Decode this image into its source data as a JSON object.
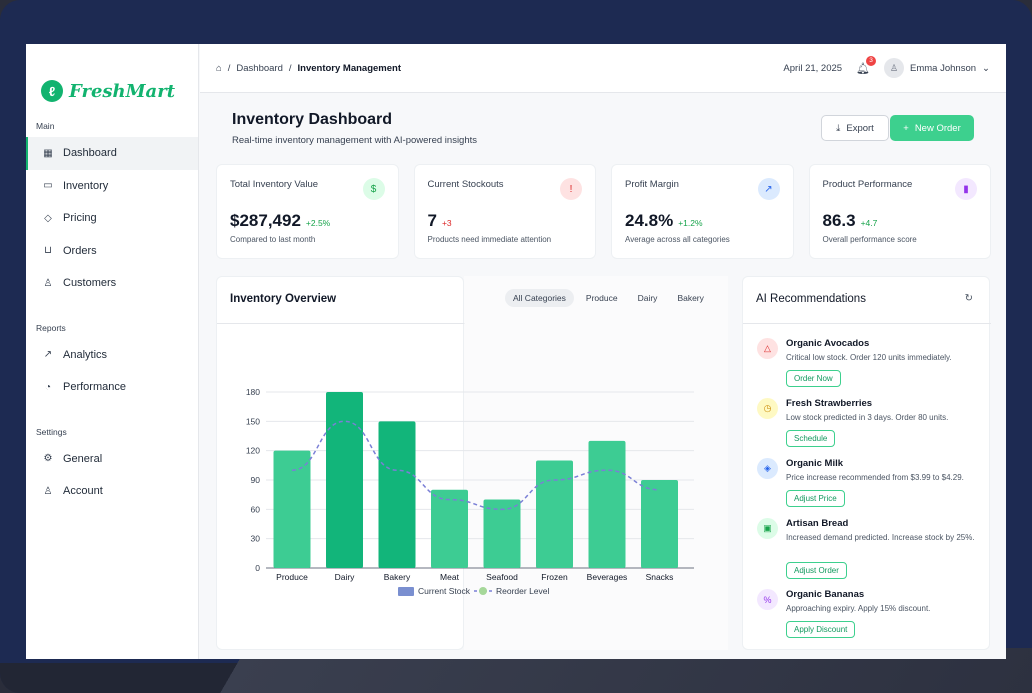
{
  "brand": {
    "name": "FreshMart"
  },
  "sidebar": {
    "sections": [
      {
        "title": "Main",
        "items": [
          {
            "label": "Dashboard",
            "icon": "dashboard-icon",
            "active": true
          },
          {
            "label": "Inventory",
            "icon": "box-icon"
          },
          {
            "label": "Pricing",
            "icon": "tag-icon"
          },
          {
            "label": "Orders",
            "icon": "cart-icon"
          },
          {
            "label": "Customers",
            "icon": "user-icon"
          }
        ]
      },
      {
        "title": "Reports",
        "items": [
          {
            "label": "Analytics",
            "icon": "line-chart-icon"
          },
          {
            "label": "Performance",
            "icon": "pie-chart-icon"
          }
        ]
      },
      {
        "title": "Settings",
        "items": [
          {
            "label": "General",
            "icon": "gear-icon"
          },
          {
            "label": "Account",
            "icon": "account-icon"
          }
        ]
      }
    ]
  },
  "topbar": {
    "breadcrumb": [
      "Dashboard",
      "Inventory Management"
    ],
    "date": "April 21, 2025",
    "notifications": "3",
    "user": "Emma Johnson"
  },
  "page": {
    "title": "Inventory Dashboard",
    "subtitle": "Real-time inventory management with AI-powered insights",
    "export_label": "Export",
    "new_order_label": "New Order"
  },
  "kpis": [
    {
      "label": "Total Inventory Value",
      "value": "$287,492",
      "delta": "+2.5%",
      "note": "Compared to last month",
      "color": "#16a34a",
      "icon_bg": "#dcfce7",
      "icon": "$"
    },
    {
      "label": "Current Stockouts",
      "value": "7",
      "delta": "+3",
      "note": "Products need immediate attention",
      "color": "#dc2626",
      "icon_bg": "#fee2e2",
      "icon": "!"
    },
    {
      "label": "Profit Margin",
      "value": "24.8%",
      "delta": "+1.2%",
      "note": "Average across all categories",
      "color": "#16a34a",
      "icon_bg": "#dbeafe",
      "icon": "↗"
    },
    {
      "label": "Product Performance",
      "value": "86.3",
      "delta": "+4.7",
      "note": "Overall performance score",
      "color": "#16a34a",
      "icon_bg": "#f3e8ff",
      "icon": "▮"
    }
  ],
  "overview": {
    "title": "Inventory Overview",
    "tabs": [
      "All Categories",
      "Produce",
      "Dairy",
      "Bakery"
    ]
  },
  "chart_data": {
    "type": "bar",
    "categories": [
      "Produce",
      "Dairy",
      "Bakery",
      "Meat",
      "Seafood",
      "Frozen",
      "Beverages",
      "Snacks"
    ],
    "series": [
      {
        "name": "Current Stock",
        "type": "bar",
        "values": [
          120,
          180,
          150,
          80,
          70,
          110,
          130,
          90
        ]
      },
      {
        "name": "Reorder Level",
        "type": "line",
        "values": [
          100,
          150,
          100,
          70,
          60,
          90,
          100,
          80
        ]
      }
    ],
    "yticks": [
      0,
      30,
      60,
      90,
      120,
      150,
      180
    ],
    "ylim": [
      0,
      180
    ],
    "legend": "bottom",
    "grid": true,
    "colors": {
      "bar": "#3dcc93",
      "bar_dark": "#12b57a",
      "line": "#7a7fd6",
      "legend_stock": "#7a8fd0",
      "legend_reorder": "#a6d89a"
    }
  },
  "ai": {
    "title": "AI Recommendations",
    "items": [
      {
        "name": "Organic Avocados",
        "desc": "Critical low stock. Order 120 units immediately.",
        "action": "Order Now",
        "icon": "alert-icon",
        "glyph": "△",
        "bg": "#fee2e2",
        "fg": "#dc2626"
      },
      {
        "name": "Fresh Strawberries",
        "desc": "Low stock predicted in 3 days. Order 80 units.",
        "action": "Schedule",
        "icon": "clock-icon",
        "glyph": "◷",
        "bg": "#fef9c3",
        "fg": "#ca8a04"
      },
      {
        "name": "Organic Milk",
        "desc": "Price increase recommended from $3.99 to $4.29.",
        "action": "Adjust Price",
        "icon": "tag-icon",
        "glyph": "◈",
        "bg": "#dbeafe",
        "fg": "#2563eb"
      },
      {
        "name": "Artisan Bread",
        "desc": "Increased demand predicted. Increase stock by 25%.",
        "action": "Adjust Order",
        "icon": "bag-icon",
        "glyph": "▣",
        "bg": "#dcfce7",
        "fg": "#16a34a"
      },
      {
        "name": "Organic Bananas",
        "desc": "Approaching expiry. Apply 15% discount.",
        "action": "Apply Discount",
        "icon": "percent-icon",
        "glyph": "%",
        "bg": "#f3e8ff",
        "fg": "#9333ea"
      }
    ]
  }
}
